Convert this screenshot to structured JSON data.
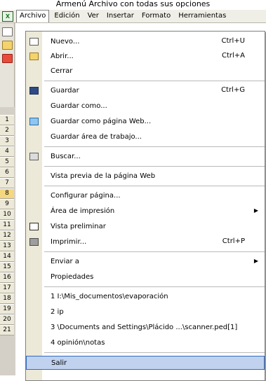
{
  "caption": "Armenú Archivo con todas sus opciones",
  "menubar": {
    "items": [
      {
        "label": "Archivo",
        "active": true
      },
      {
        "label": "Edición",
        "active": false
      },
      {
        "label": "Ver",
        "active": false
      },
      {
        "label": "Insertar",
        "active": false
      },
      {
        "label": "Formato",
        "active": false
      },
      {
        "label": "Herramientas",
        "active": false
      }
    ]
  },
  "rows": [
    "1",
    "2",
    "3",
    "4",
    "5",
    "6",
    "7",
    "8",
    "9",
    "10",
    "11",
    "12",
    "13",
    "14",
    "15",
    "16",
    "17",
    "18",
    "19",
    "20",
    "21"
  ],
  "selected_row": "8",
  "menu": {
    "items": [
      {
        "label": "Nuevo...",
        "shortcut": "Ctrl+U",
        "icon": "new-document-icon"
      },
      {
        "label": "Abrir...",
        "shortcut": "Ctrl+A",
        "icon": "open-folder-icon"
      },
      {
        "label": "Cerrar",
        "shortcut": "",
        "icon": ""
      },
      {
        "label": "Guardar",
        "shortcut": "Ctrl+G",
        "icon": "save-icon"
      },
      {
        "label": "Guardar como...",
        "shortcut": "",
        "icon": ""
      },
      {
        "label": "Guardar como página Web...",
        "shortcut": "",
        "icon": "web-page-icon"
      },
      {
        "label": "Guardar área de trabajo...",
        "shortcut": "",
        "icon": ""
      },
      {
        "label": "Buscar...",
        "shortcut": "",
        "icon": "search-icon"
      },
      {
        "label": "Vista previa de la página Web",
        "shortcut": "",
        "icon": ""
      },
      {
        "label": "Configurar página...",
        "shortcut": "",
        "icon": ""
      },
      {
        "label": "Área de impresión",
        "shortcut": "",
        "icon": "",
        "submenu": true
      },
      {
        "label": "Vista preliminar",
        "shortcut": "",
        "icon": "print-preview-icon"
      },
      {
        "label": "Imprimir...",
        "shortcut": "Ctrl+P",
        "icon": "printer-icon"
      },
      {
        "label": "Enviar a",
        "shortcut": "",
        "icon": "",
        "submenu": true
      },
      {
        "label": "Propiedades",
        "shortcut": "",
        "icon": ""
      },
      {
        "label": "1 I:\\Mis_documentos\\evaporación",
        "shortcut": "",
        "icon": ""
      },
      {
        "label": "2 ip",
        "shortcut": "",
        "icon": ""
      },
      {
        "label": "3 \\Documents and Settings\\Plácido ...\\scanner.ped[1]",
        "shortcut": "",
        "icon": ""
      },
      {
        "label": "4 opinión\\notas",
        "shortcut": "",
        "icon": ""
      },
      {
        "label": "Salir",
        "shortcut": "",
        "icon": "",
        "hover": true
      }
    ]
  },
  "colors": {
    "hover_fill": "#c1d2ee",
    "hover_border": "#316ac5",
    "gutter": "#ece9d8",
    "selected_row": "#f5d77f"
  }
}
